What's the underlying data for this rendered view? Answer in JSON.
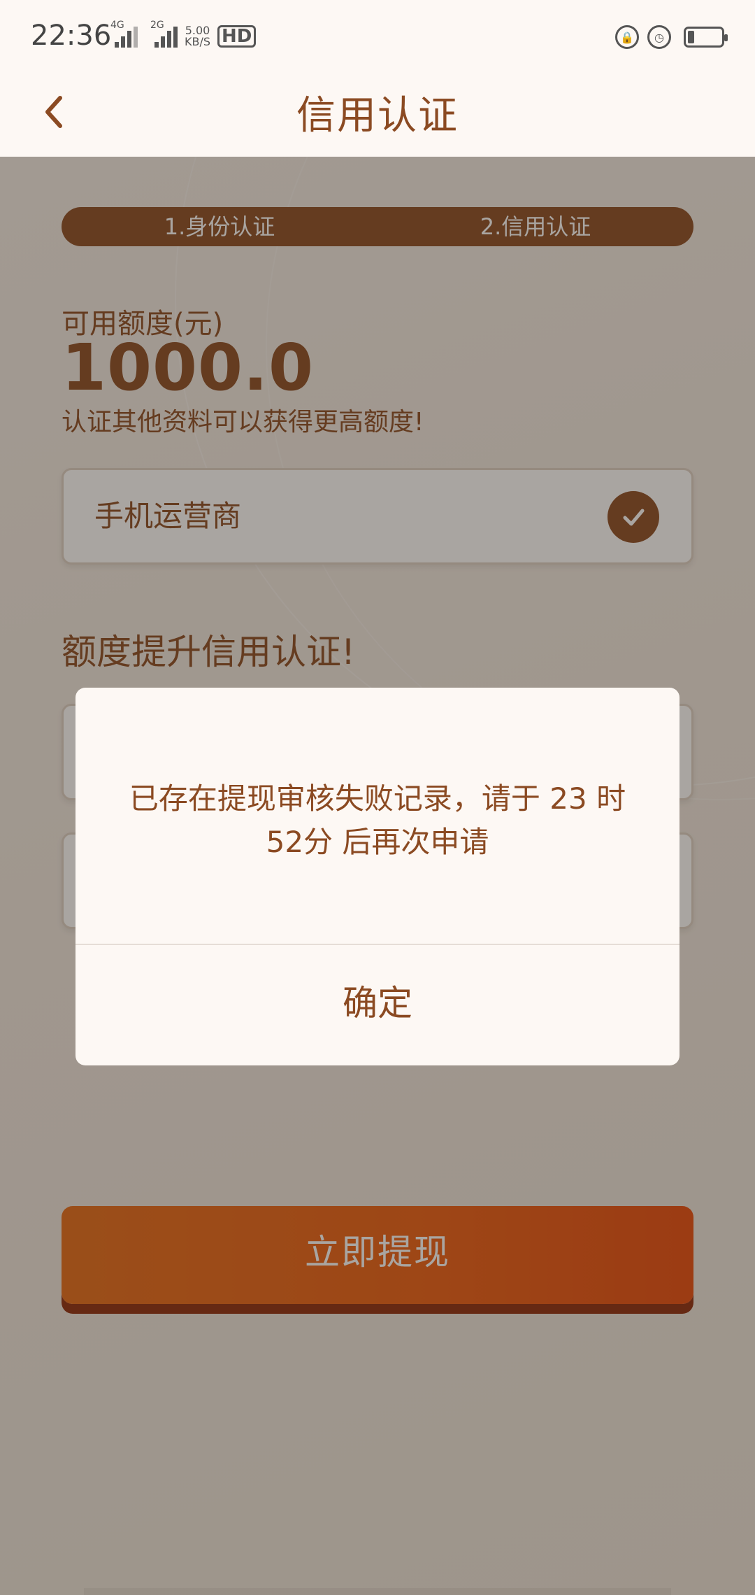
{
  "status_bar": {
    "time": "22:36",
    "network_1": "4G",
    "network_2": "2G",
    "speed_value": "5.00",
    "speed_unit": "KB/S",
    "hd_label": "HD",
    "battery_level": 0.2
  },
  "header": {
    "back_icon": "chevron-left-icon",
    "title": "信用认证"
  },
  "steps": [
    {
      "label": "1.身份认证"
    },
    {
      "label": "2.信用认证"
    }
  ],
  "quota": {
    "label": "可用额度(元)",
    "value": "1000.0",
    "hint": "认证其他资料可以获得更高额度!"
  },
  "auth_items": [
    {
      "label": "手机运营商",
      "status_icon": "check-icon",
      "done": true
    }
  ],
  "section_title": "额度提升信用认证!",
  "withdraw_button": "立即提现",
  "dialog": {
    "message": "已存在提现审核失败记录，请于 23 时52分 后再次申请",
    "confirm": "确定"
  },
  "colors": {
    "brand_brown": "#8b4a22",
    "button_orange": "#ec5c10",
    "background": "#fdf8f4"
  }
}
